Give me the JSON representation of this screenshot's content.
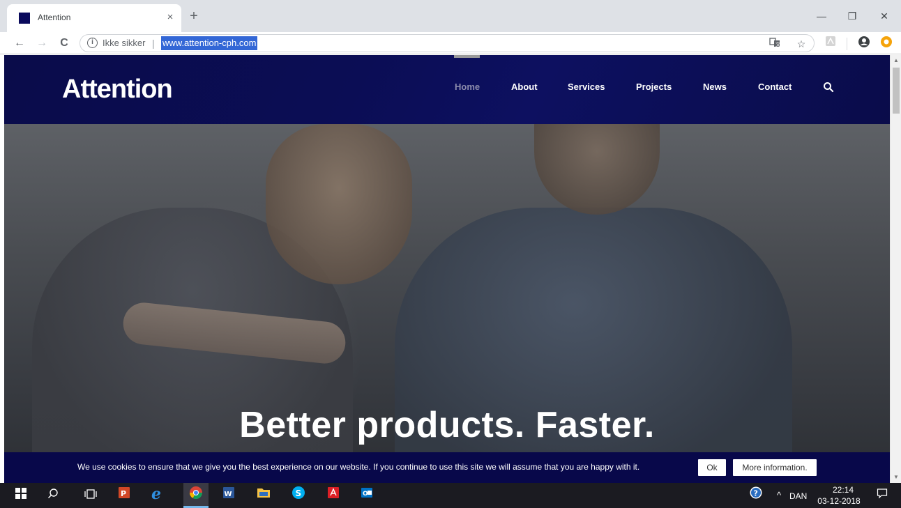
{
  "browser": {
    "tab_title": "Attention",
    "close_tab_glyph": "×",
    "new_tab_glyph": "+",
    "security_label": "Ikke sikker",
    "separator": "|",
    "url": "www.attention-cph.com",
    "window_controls": [
      "—",
      "❐",
      "✕"
    ],
    "nav": {
      "back": "←",
      "forward": "→",
      "reload": "C"
    }
  },
  "site": {
    "brand": "Attention",
    "nav_items": [
      {
        "label": "Home",
        "active": true
      },
      {
        "label": "About"
      },
      {
        "label": "Services"
      },
      {
        "label": "Projects"
      },
      {
        "label": "News"
      },
      {
        "label": "Contact"
      }
    ],
    "hero_title": "Better products. Faster."
  },
  "cookie": {
    "text": "We use cookies to ensure that we give you the best experience on our website. If you continue to use this site we will assume that you are happy with it.",
    "ok_label": "Ok",
    "more_label": "More information."
  },
  "taskbar": {
    "language": "DAN",
    "time": "22:14",
    "date": "03-12-2018",
    "apps": [
      "windows-start",
      "search",
      "task-view",
      "powerpoint",
      "edge",
      "chrome",
      "word",
      "file-explorer",
      "skype",
      "acrobat",
      "outlook"
    ]
  },
  "colors": {
    "header_navy": "#0b0d55",
    "cookie_navy": "#08084a",
    "selection_blue": "#3367d6"
  }
}
